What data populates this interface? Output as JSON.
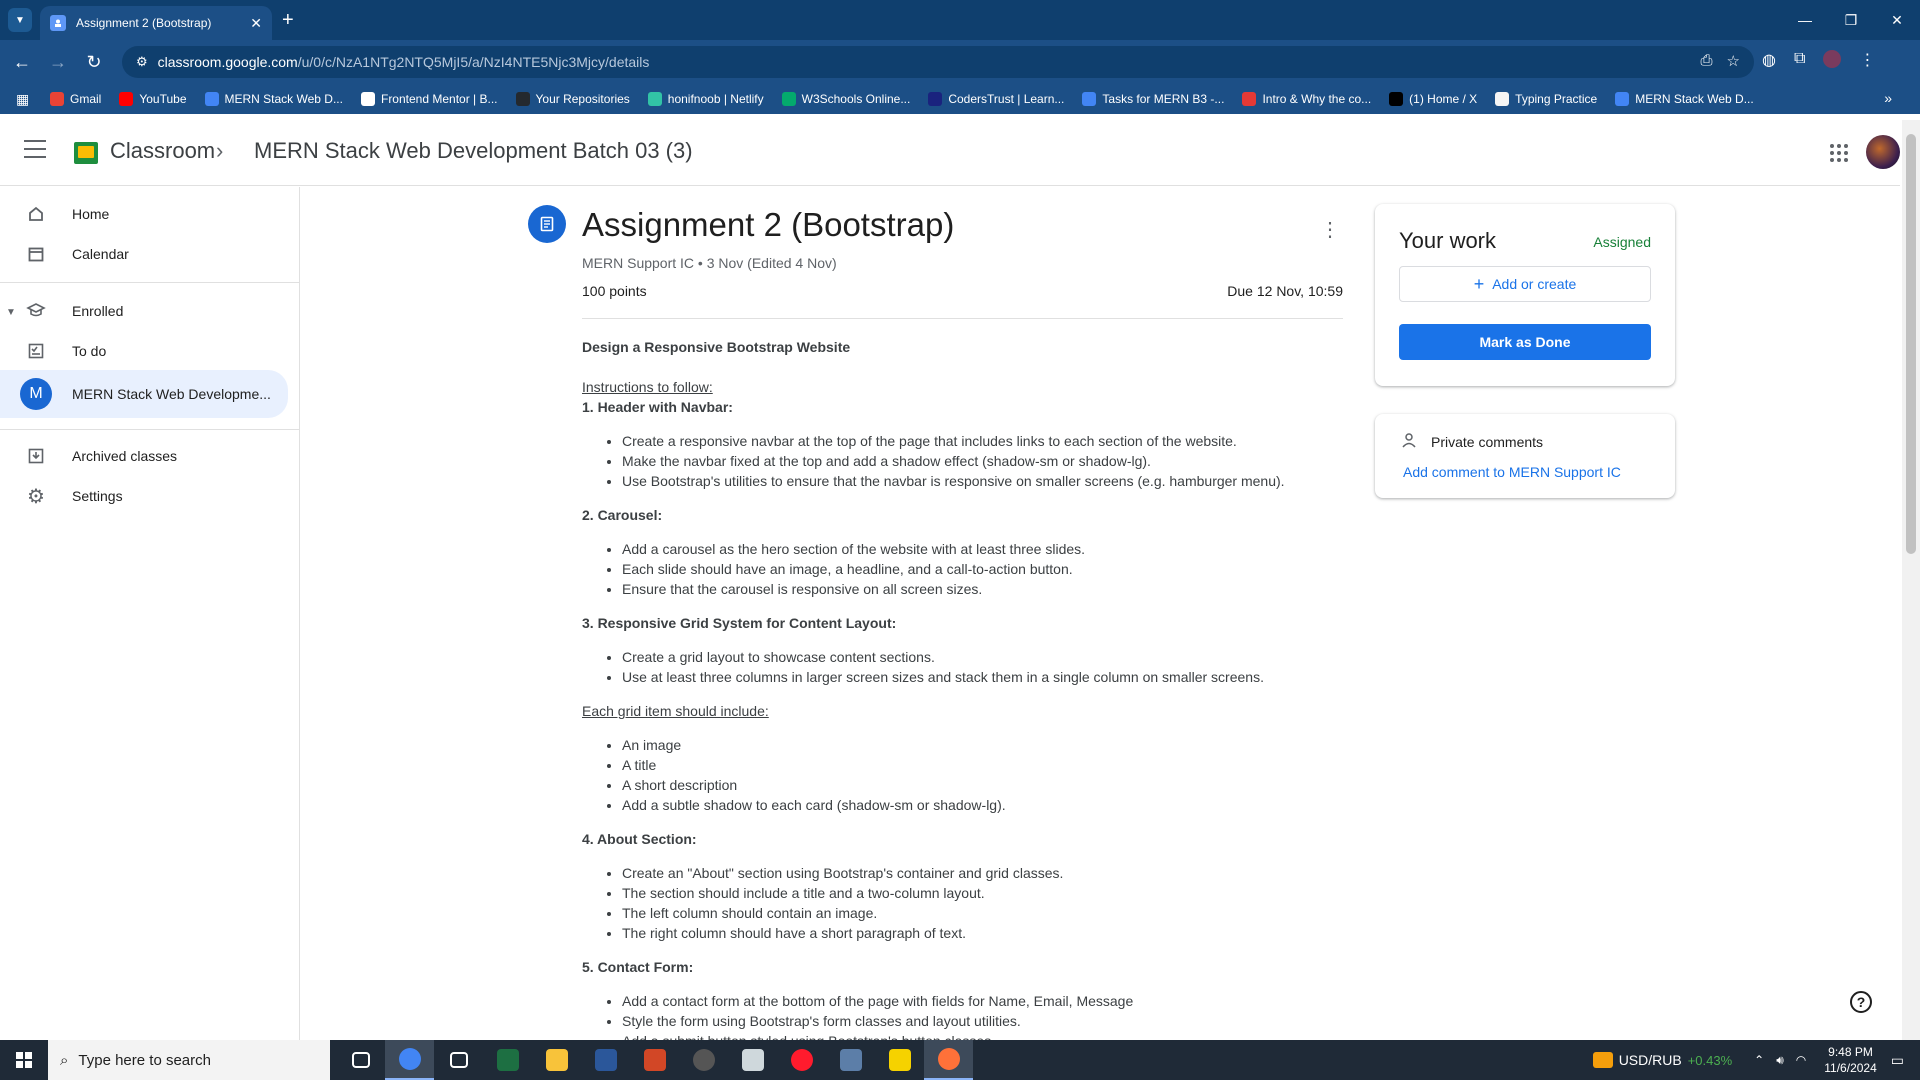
{
  "browser": {
    "tab_title": "Assignment 2 (Bootstrap)",
    "url_host": "classroom.google.com",
    "url_path": "/u/0/c/NzA1NTg2NTQ5MjI5/a/NzI4NTE5Njc3Mjcy/details",
    "bookmarks": [
      {
        "label": "Gmail",
        "color": "#ea4335"
      },
      {
        "label": "YouTube",
        "color": "#ff0000"
      },
      {
        "label": "MERN Stack Web D...",
        "color": "#4285f4"
      },
      {
        "label": "Frontend Mentor | B...",
        "color": "#ffffff"
      },
      {
        "label": "Your Repositories",
        "color": "#24292e"
      },
      {
        "label": "honifnoob | Netlify",
        "color": "#32c3a6"
      },
      {
        "label": "W3Schools Online...",
        "color": "#04aa6d"
      },
      {
        "label": "CodersTrust | Learn...",
        "color": "#1a237e"
      },
      {
        "label": "Tasks for MERN B3 -...",
        "color": "#4285f4"
      },
      {
        "label": "Intro & Why the co...",
        "color": "#e53935"
      },
      {
        "label": "(1) Home / X",
        "color": "#000000"
      },
      {
        "label": "Typing Practice",
        "color": "#f5f5f5"
      },
      {
        "label": "MERN Stack Web D...",
        "color": "#4285f4"
      }
    ]
  },
  "header": {
    "brand": "Classroom",
    "class_name": "MERN Stack Web Development Batch 03 (3)"
  },
  "sidebar": {
    "items": [
      {
        "label": "Home",
        "icon": "home-icon"
      },
      {
        "label": "Calendar",
        "icon": "calendar-icon"
      },
      {
        "label": "Enrolled",
        "icon": "enrolled-icon"
      },
      {
        "label": "To do",
        "icon": "todo-icon"
      },
      {
        "label": "MERN Stack Web Developme...",
        "icon": "class-avatar",
        "avatar_letter": "M"
      },
      {
        "label": "Archived classes",
        "icon": "archive-icon"
      },
      {
        "label": "Settings",
        "icon": "gear-icon"
      }
    ]
  },
  "assignment": {
    "title": "Assignment 2 (Bootstrap)",
    "meta": "MERN Support IC • 3 Nov (Edited 4 Nov)",
    "points": "100 points",
    "due": "Due 12 Nov, 10:59",
    "heading": "Design a Responsive Bootstrap Website",
    "instructions_label": "Instructions to follow:",
    "sections": [
      {
        "title": "1. Header with Navbar:",
        "items": [
          "Create a responsive navbar at the top of the page that includes links to each section of the website.",
          "Make the navbar fixed at the top and add a shadow effect (shadow-sm or shadow-lg).",
          "Use Bootstrap's utilities to ensure that the navbar is responsive on smaller screens (e.g. hamburger menu)."
        ]
      },
      {
        "title": "2. Carousel:",
        "items": [
          "Add a carousel as the hero section of the website with at least three slides.",
          "Each slide should have an image, a headline, and a call-to-action button.",
          "Ensure that the carousel is responsive on all screen sizes."
        ]
      },
      {
        "title": "3. Responsive Grid System for Content Layout:",
        "items": [
          "Create a grid layout to showcase content sections.",
          "Use at least three columns in larger screen sizes and stack them in a single column on smaller screens."
        ]
      }
    ],
    "grid_item_label": "Each grid item should include:",
    "grid_items": [
      "An image",
      "A title",
      "A short description",
      "Add a subtle shadow to each card (shadow-sm or shadow-lg)."
    ],
    "sections_after": [
      {
        "title": "4. About Section:",
        "items": [
          "Create an \"About\" section using Bootstrap's container and grid classes.",
          "The section should include a title and a two-column layout.",
          "The left column should contain an image.",
          "The right column should have a short paragraph of text."
        ]
      },
      {
        "title": "5. Contact Form:",
        "items": [
          "Add a contact form at the bottom of the page with fields for Name, Email, Message",
          "Style the form using Bootstrap's form classes and layout utilities.",
          "Add a submit button styled using Bootstrap's button classes."
        ]
      }
    ]
  },
  "your_work": {
    "title": "Your work",
    "status": "Assigned",
    "add_label": "Add or create",
    "done_label": "Mark as Done"
  },
  "comments": {
    "title": "Private comments",
    "link": "Add comment to MERN Support IC"
  },
  "taskbar": {
    "search_placeholder": "Type here to search",
    "ticker_label": "USD/RUB",
    "ticker_change": "+0.43%",
    "time": "9:48 PM",
    "date": "11/6/2024",
    "apps": [
      {
        "name": "task-view-icon",
        "color": "#ffffff"
      },
      {
        "name": "chrome-icon",
        "color": "#4285f4"
      },
      {
        "name": "security-icon",
        "color": "#ffffff"
      },
      {
        "name": "excel-icon",
        "color": "#1d6f42"
      },
      {
        "name": "file-explorer-icon",
        "color": "#f8c33a"
      },
      {
        "name": "word-icon",
        "color": "#2b579a"
      },
      {
        "name": "powerpoint-icon",
        "color": "#d24726"
      },
      {
        "name": "media-player-icon",
        "color": "#555555"
      },
      {
        "name": "app-icon",
        "color": "#cfd8dc"
      },
      {
        "name": "opera-icon",
        "color": "#ff1b2d"
      },
      {
        "name": "calculator-icon",
        "color": "#5c7ea8"
      },
      {
        "name": "sticky-notes-icon",
        "color": "#f6d200"
      },
      {
        "name": "firefox-icon",
        "color": "#ff7139"
      }
    ]
  }
}
